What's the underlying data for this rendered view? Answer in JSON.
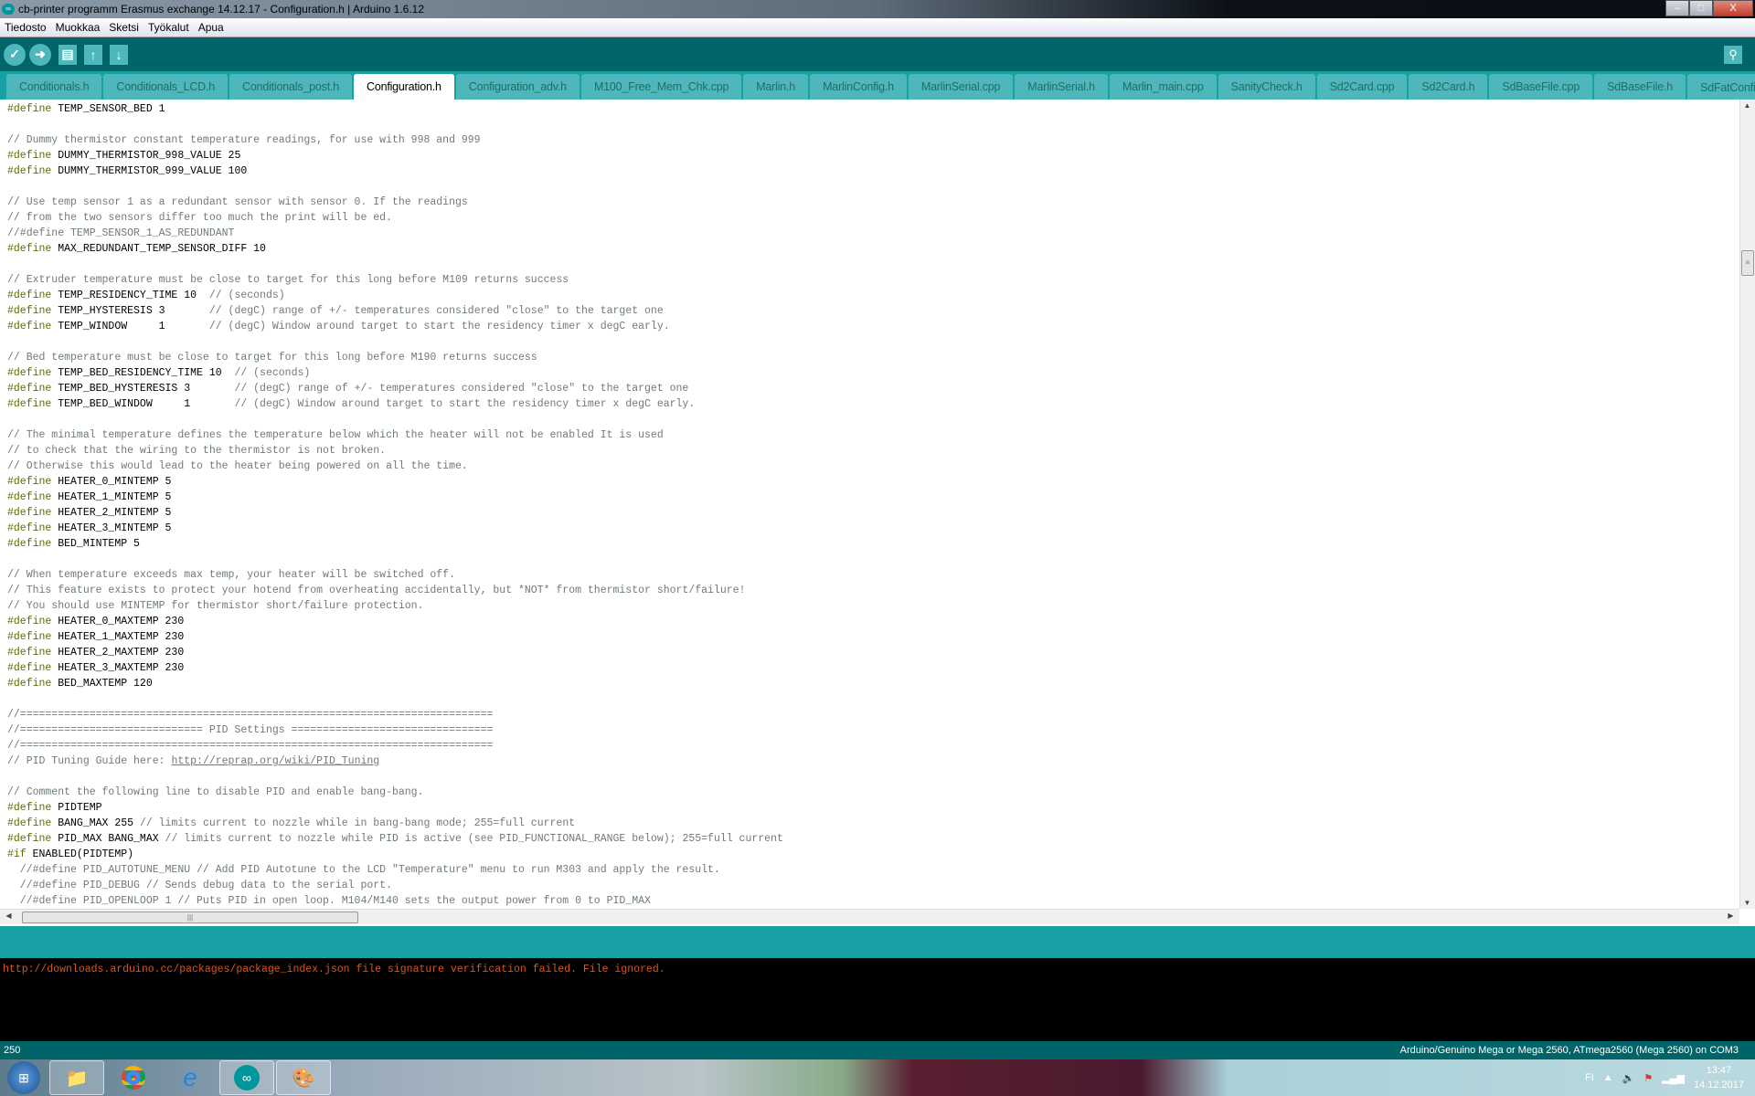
{
  "window": {
    "title": "cb-printer programm Erasmus exchange 14.12.17 - Configuration.h | Arduino 1.6.12",
    "minimize": "–",
    "maximize": "□",
    "close": "X"
  },
  "menu": [
    "Tiedosto",
    "Muokkaa",
    "Sketsi",
    "Työkalut",
    "Apua"
  ],
  "toolbar": {
    "verify": "✓",
    "upload": "➜",
    "new": "▤",
    "open": "↑",
    "save": "↓",
    "serial_monitor": "⚲"
  },
  "tabs": [
    {
      "label": "Conditionals.h"
    },
    {
      "label": "Conditionals_LCD.h"
    },
    {
      "label": "Conditionals_post.h"
    },
    {
      "label": "Configuration.h",
      "active": true
    },
    {
      "label": "Configuration_adv.h"
    },
    {
      "label": "M100_Free_Mem_Chk.cpp"
    },
    {
      "label": "Marlin.h"
    },
    {
      "label": "MarlinConfig.h"
    },
    {
      "label": "MarlinSerial.cpp"
    },
    {
      "label": "MarlinSerial.h"
    },
    {
      "label": "Marlin_main.cpp"
    },
    {
      "label": "SanityCheck.h"
    },
    {
      "label": "Sd2Card.cpp"
    },
    {
      "label": "Sd2Card.h"
    },
    {
      "label": "SdBaseFile.cpp"
    },
    {
      "label": "SdBaseFile.h"
    },
    {
      "label": "SdFatConfig ▾"
    }
  ],
  "editor": {
    "lines": [
      {
        "k": "#define",
        "c": " TEMP_SENSOR_BED 1"
      },
      {},
      {
        "m": "// Dummy thermistor constant temperature readings, for use with 998 and 999"
      },
      {
        "k": "#define",
        "c": " DUMMY_THERMISTOR_998_VALUE 25"
      },
      {
        "k": "#define",
        "c": " DUMMY_THERMISTOR_999_VALUE 100"
      },
      {},
      {
        "m": "// Use temp sensor 1 as a redundant sensor with sensor 0. If the readings"
      },
      {
        "m": "// from the two sensors differ too much the print will be ed."
      },
      {
        "m": "//#define TEMP_SENSOR_1_AS_REDUNDANT"
      },
      {
        "k": "#define",
        "c": " MAX_REDUNDANT_TEMP_SENSOR_DIFF 10"
      },
      {},
      {
        "m": "// Extruder temperature must be close to target for this long before M109 returns success"
      },
      {
        "k": "#define",
        "c": " TEMP_RESIDENCY_TIME 10  ",
        "m": "// (seconds)"
      },
      {
        "k": "#define",
        "c": " TEMP_HYSTERESIS 3       ",
        "m": "// (degC) range of +/- temperatures considered \"close\" to the target one"
      },
      {
        "k": "#define",
        "c": " TEMP_WINDOW     1       ",
        "m": "// (degC) Window around target to start the residency timer x degC early."
      },
      {},
      {
        "m": "// Bed temperature must be close to target for this long before M190 returns success"
      },
      {
        "k": "#define",
        "c": " TEMP_BED_RESIDENCY_TIME 10  ",
        "m": "// (seconds)"
      },
      {
        "k": "#define",
        "c": " TEMP_BED_HYSTERESIS 3       ",
        "m": "// (degC) range of +/- temperatures considered \"close\" to the target one"
      },
      {
        "k": "#define",
        "c": " TEMP_BED_WINDOW     1       ",
        "m": "// (degC) Window around target to start the residency timer x degC early."
      },
      {},
      {
        "m": "// The minimal temperature defines the temperature below which the heater will not be enabled It is used"
      },
      {
        "m": "// to check that the wiring to the thermistor is not broken."
      },
      {
        "m": "// Otherwise this would lead to the heater being powered on all the time."
      },
      {
        "k": "#define",
        "c": " HEATER_0_MINTEMP 5"
      },
      {
        "k": "#define",
        "c": " HEATER_1_MINTEMP 5"
      },
      {
        "k": "#define",
        "c": " HEATER_2_MINTEMP 5"
      },
      {
        "k": "#define",
        "c": " HEATER_3_MINTEMP 5"
      },
      {
        "k": "#define",
        "c": " BED_MINTEMP 5"
      },
      {},
      {
        "m": "// When temperature exceeds max temp, your heater will be switched off."
      },
      {
        "m": "// This feature exists to protect your hotend from overheating accidentally, but *NOT* from thermistor short/failure!"
      },
      {
        "m": "// You should use MINTEMP for thermistor short/failure protection."
      },
      {
        "k": "#define",
        "c": " HEATER_0_MAXTEMP 230"
      },
      {
        "k": "#define",
        "c": " HEATER_1_MAXTEMP 230"
      },
      {
        "k": "#define",
        "c": " HEATER_2_MAXTEMP 230"
      },
      {
        "k": "#define",
        "c": " HEATER_3_MAXTEMP 230"
      },
      {
        "k": "#define",
        "c": " BED_MAXTEMP 120"
      },
      {},
      {
        "m": "//==========================================================================="
      },
      {
        "m": "//============================= PID Settings ================================"
      },
      {
        "m": "//==========================================================================="
      },
      {
        "m": "// PID Tuning Guide here: ",
        "l": "http://reprap.org/wiki/PID_Tuning"
      },
      {},
      {
        "m": "// Comment the following line to disable PID and enable bang-bang."
      },
      {
        "k": "#define",
        "c": " PIDTEMP"
      },
      {
        "k": "#define",
        "c": " BANG_MAX 255 ",
        "m": "// limits current to nozzle while in bang-bang mode; 255=full current"
      },
      {
        "k": "#define",
        "c": " PID_MAX BANG_MAX ",
        "m": "// limits current to nozzle while PID is active (see PID_FUNCTIONAL_RANGE below); 255=full current"
      },
      {
        "k": "#if",
        "c": " ENABLED(PIDTEMP)"
      },
      {
        "m": "  //#define PID_AUTOTUNE_MENU // Add PID Autotune to the LCD \"Temperature\" menu to run M303 and apply the result."
      },
      {
        "m": "  //#define PID_DEBUG // Sends debug data to the serial port."
      },
      {
        "m": "  //#define PID_OPENLOOP 1 // Puts PID in open loop. M104/M140 sets the output power from 0 to PID_MAX"
      }
    ]
  },
  "console": {
    "message": "http://downloads.arduino.cc/packages/package_index.json file signature verification failed. File ignored."
  },
  "statusbar": {
    "line": "250",
    "board": "Arduino/Genuino Mega or Mega 2560, ATmega2560 (Mega 2560) on COM3"
  },
  "taskbar": {
    "language": "FI",
    "time": "13:47",
    "date": "14.12.2017"
  },
  "colors": {
    "toolbar": "#006468",
    "tabs_bg": "#17a1a5",
    "tab": "#4db7bb",
    "keyword": "#5e6d03",
    "console_error": "#e0531d"
  }
}
